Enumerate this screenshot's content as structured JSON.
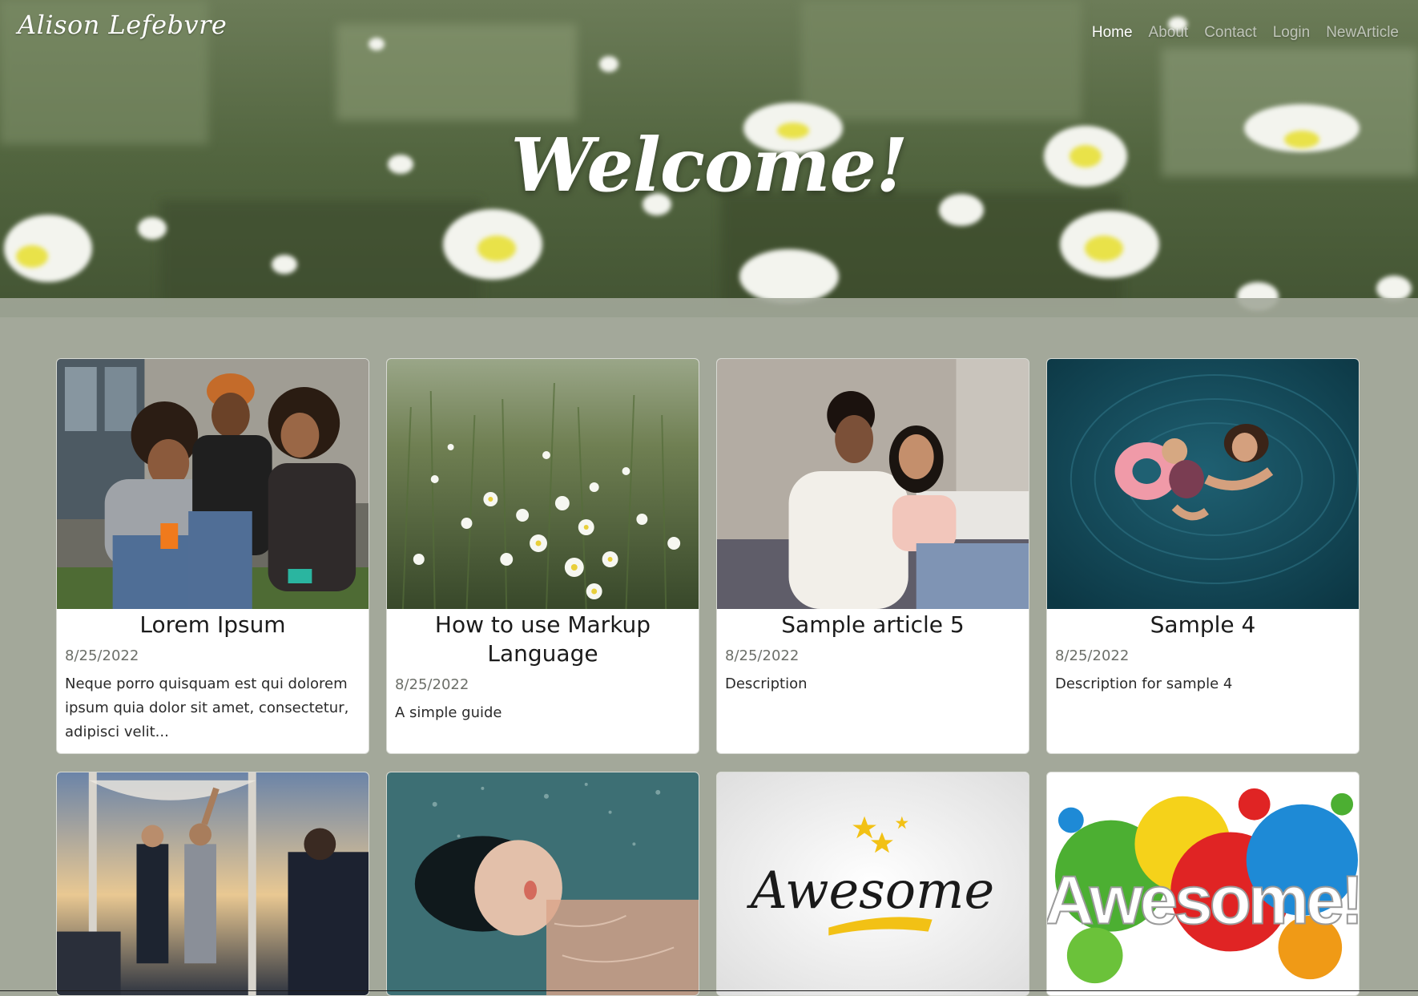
{
  "header": {
    "brand": "Alison Lefebvre",
    "nav": [
      {
        "label": "Home",
        "active": true
      },
      {
        "label": "About",
        "active": false
      },
      {
        "label": "Contact",
        "active": false
      },
      {
        "label": "Login",
        "active": false
      },
      {
        "label": "NewArticle",
        "active": false
      }
    ],
    "hero_title": "Welcome!"
  },
  "articles": [
    {
      "title": "Lorem Ipsum",
      "date": "8/25/2022",
      "description": "Neque porro quisquam est qui dolorem ipsum quia dolor sit amet, consectetur, adipisci velit..."
    },
    {
      "title": "How to use Markup Language",
      "date": "8/25/2022",
      "description": "A simple guide"
    },
    {
      "title": "Sample article 5",
      "date": "8/25/2022",
      "description": "Description"
    },
    {
      "title": "Sample 4",
      "date": "8/25/2022",
      "description": "Description for sample 4"
    }
  ],
  "bottom_row_images": [
    {
      "image": "wedding-photo"
    },
    {
      "image": "woman-in-water-photo"
    },
    {
      "image_text": "Awesome"
    },
    {
      "image_text": "Awesome!"
    }
  ],
  "colors": {
    "page_background": "#a3a89a",
    "nav_active": "#ffffff",
    "nav_inactive": "rgba(255,255,255,0.62)"
  }
}
